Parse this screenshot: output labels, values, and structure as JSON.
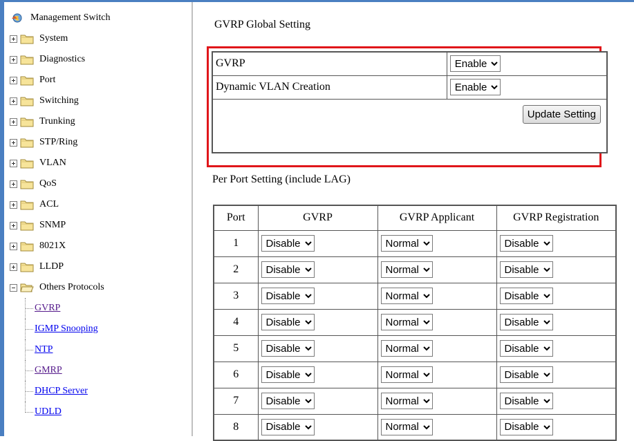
{
  "colors": {
    "accent": "#4a7fc1",
    "highlight": "#e0161a",
    "link": "#0000ee",
    "visited": "#551a8b"
  },
  "sidebar": {
    "root": {
      "label": "Management Switch",
      "icon": "globe-icon"
    },
    "items": [
      {
        "label": "System"
      },
      {
        "label": "Diagnostics"
      },
      {
        "label": "Port"
      },
      {
        "label": "Switching"
      },
      {
        "label": "Trunking"
      },
      {
        "label": "STP/Ring"
      },
      {
        "label": "VLAN"
      },
      {
        "label": "QoS"
      },
      {
        "label": "ACL"
      },
      {
        "label": "SNMP"
      },
      {
        "label": "8021X"
      },
      {
        "label": "LLDP"
      }
    ],
    "expanded": {
      "label": "Others Protocols",
      "children": [
        {
          "label": "GVRP"
        },
        {
          "label": "IGMP Snooping"
        },
        {
          "label": "NTP"
        },
        {
          "label": "GMRP"
        },
        {
          "label": "DHCP Server"
        },
        {
          "label": "UDLD"
        }
      ]
    }
  },
  "global": {
    "title": "GVRP Global Setting",
    "rows": [
      {
        "label": "GVRP",
        "value": "Enable"
      },
      {
        "label": "Dynamic VLAN Creation",
        "value": "Enable"
      }
    ],
    "update_button": "Update Setting"
  },
  "per_port": {
    "title": "Per Port Setting (include LAG)",
    "headers": [
      "Port",
      "GVRP",
      "GVRP Applicant",
      "GVRP Registration"
    ],
    "rows": [
      {
        "port": "1",
        "gvrp": "Disable",
        "applicant": "Normal",
        "registration": "Disable"
      },
      {
        "port": "2",
        "gvrp": "Disable",
        "applicant": "Normal",
        "registration": "Disable"
      },
      {
        "port": "3",
        "gvrp": "Disable",
        "applicant": "Normal",
        "registration": "Disable"
      },
      {
        "port": "4",
        "gvrp": "Disable",
        "applicant": "Normal",
        "registration": "Disable"
      },
      {
        "port": "5",
        "gvrp": "Disable",
        "applicant": "Normal",
        "registration": "Disable"
      },
      {
        "port": "6",
        "gvrp": "Disable",
        "applicant": "Normal",
        "registration": "Disable"
      },
      {
        "port": "7",
        "gvrp": "Disable",
        "applicant": "Normal",
        "registration": "Disable"
      },
      {
        "port": "8",
        "gvrp": "Disable",
        "applicant": "Normal",
        "registration": "Disable"
      }
    ]
  }
}
